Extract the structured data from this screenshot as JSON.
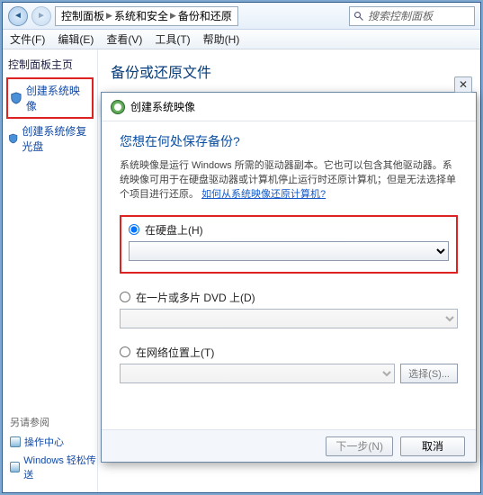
{
  "address_bar": {
    "crumb1": "控制面板",
    "crumb2": "系统和安全",
    "crumb3": "备份和还原",
    "search_placeholder": "搜索控制面板"
  },
  "menubar": {
    "file": "文件(F)",
    "edit": "编辑(E)",
    "view": "查看(V)",
    "tools": "工具(T)",
    "help": "帮助(H)"
  },
  "sidebar": {
    "header": "控制面板主页",
    "items": [
      {
        "label": "创建系统映像"
      },
      {
        "label": "创建系统修复光盘"
      }
    ]
  },
  "seealso": {
    "header": "另请参阅",
    "links": [
      "操作中心",
      "Windows 轻松传送"
    ]
  },
  "page": {
    "title": "备份或还原文件"
  },
  "dialog": {
    "title": "创建系统映像",
    "question": "您想在何处保存备份?",
    "description_prefix": "系统映像是运行 Windows 所需的驱动器副本。它也可以包含其他驱动器。系统映像可用于在硬盘驱动器或计算机停止运行时还原计算机；但是无法选择单个项目进行还原。",
    "description_link": "如何从系统映像还原计算机?",
    "options": {
      "hdd": "在硬盘上(H)",
      "dvd": "在一片或多片 DVD 上(D)",
      "net": "在网络位置上(T)"
    },
    "browse": "选择(S)...",
    "next": "下一步(N)",
    "cancel": "取消"
  }
}
